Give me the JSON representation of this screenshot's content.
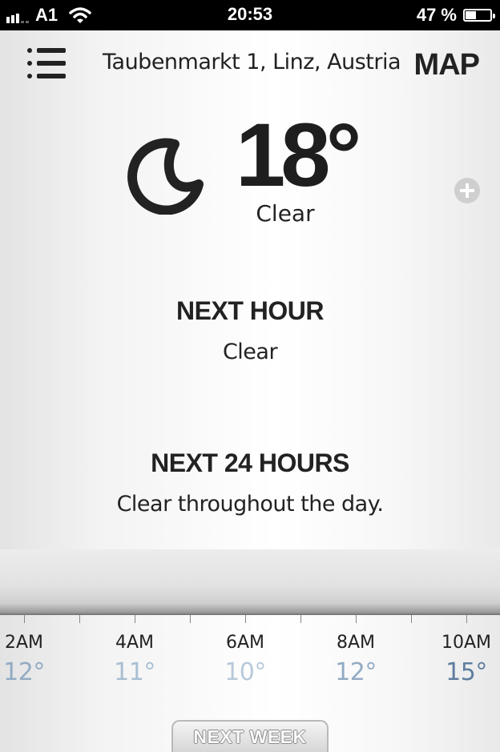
{
  "status_bar": {
    "carrier": "A1",
    "time": "20:53",
    "battery": "47 %",
    "battery_level": 0.47
  },
  "header": {
    "menu_icon": "list-menu-icon",
    "location": "Taubenmarkt 1, Linz, Austria",
    "map_label": "MAP"
  },
  "current": {
    "icon": "moon-icon",
    "temperature": "18°",
    "condition": "Clear",
    "add_icon": "plus-circle-icon"
  },
  "next_hour": {
    "title": "NEXT HOUR",
    "summary": "Clear"
  },
  "next_24": {
    "title": "NEXT 24 HOURS",
    "summary": "Clear throughout the day."
  },
  "hourly": [
    {
      "time": "2AM",
      "temp": "12°",
      "color": "#93abc4"
    },
    {
      "time": "4AM",
      "temp": "11°",
      "color": "#a9bfd3"
    },
    {
      "time": "6AM",
      "temp": "10°",
      "color": "#b8c9da"
    },
    {
      "time": "8AM",
      "temp": "12°",
      "color": "#93abc4"
    },
    {
      "time": "10AM",
      "temp": "15°",
      "color": "#5f7e9e"
    }
  ],
  "next_week_label": "NEXT WEEK"
}
